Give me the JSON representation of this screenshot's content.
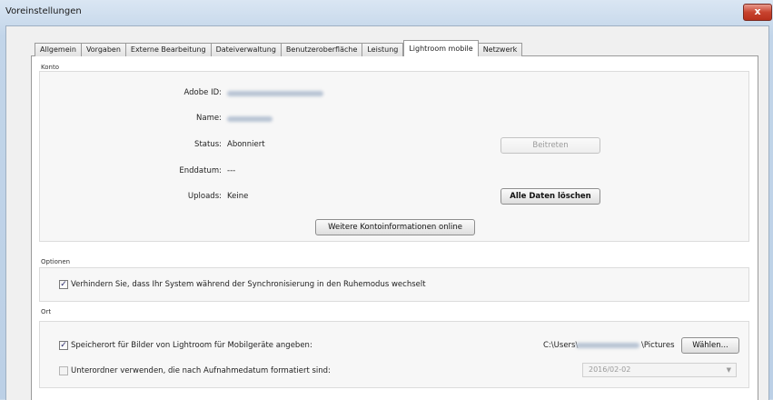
{
  "window": {
    "title": "Voreinstellungen",
    "close_label": "x"
  },
  "tabs": [
    {
      "label": "Allgemein",
      "active": false
    },
    {
      "label": "Vorgaben",
      "active": false
    },
    {
      "label": "Externe Bearbeitung",
      "active": false
    },
    {
      "label": "Dateiverwaltung",
      "active": false
    },
    {
      "label": "Benutzeroberfläche",
      "active": false
    },
    {
      "label": "Leistung",
      "active": false
    },
    {
      "label": "Lightroom mobile",
      "active": true
    },
    {
      "label": "Netzwerk",
      "active": false
    }
  ],
  "konto": {
    "group_label": "Konto",
    "adobe_id_label": "Adobe ID:",
    "name_label": "Name:",
    "status_label": "Status:",
    "status_value": "Abonniert",
    "enddatum_label": "Enddatum:",
    "enddatum_value": "---",
    "uploads_label": "Uploads:",
    "uploads_value": "Keine",
    "beitreten_button": "Beitreten",
    "alle_daten_button": "Alle Daten löschen",
    "weitere_button": "Weitere Kontoinformationen online"
  },
  "optionen": {
    "group_label": "Optionen",
    "ruhemodus_label": "Verhindern Sie, dass Ihr System während der Synchronisierung in den Ruhemodus wechselt",
    "ruhemodus_checked": true
  },
  "ort": {
    "group_label": "Ort",
    "speicherort_label": "Speicherort für Bilder von Lightroom für Mobilgeräte angeben:",
    "speicherort_checked": true,
    "path_prefix": "C:\\Users\\",
    "path_suffix": "\\Pictures",
    "waehlen_button": "Wählen...",
    "unterordner_label": "Unterordner verwenden, die nach Aufnahmedatum formatiert sind:",
    "unterordner_checked": false,
    "date_format_value": "2016/02-02"
  }
}
